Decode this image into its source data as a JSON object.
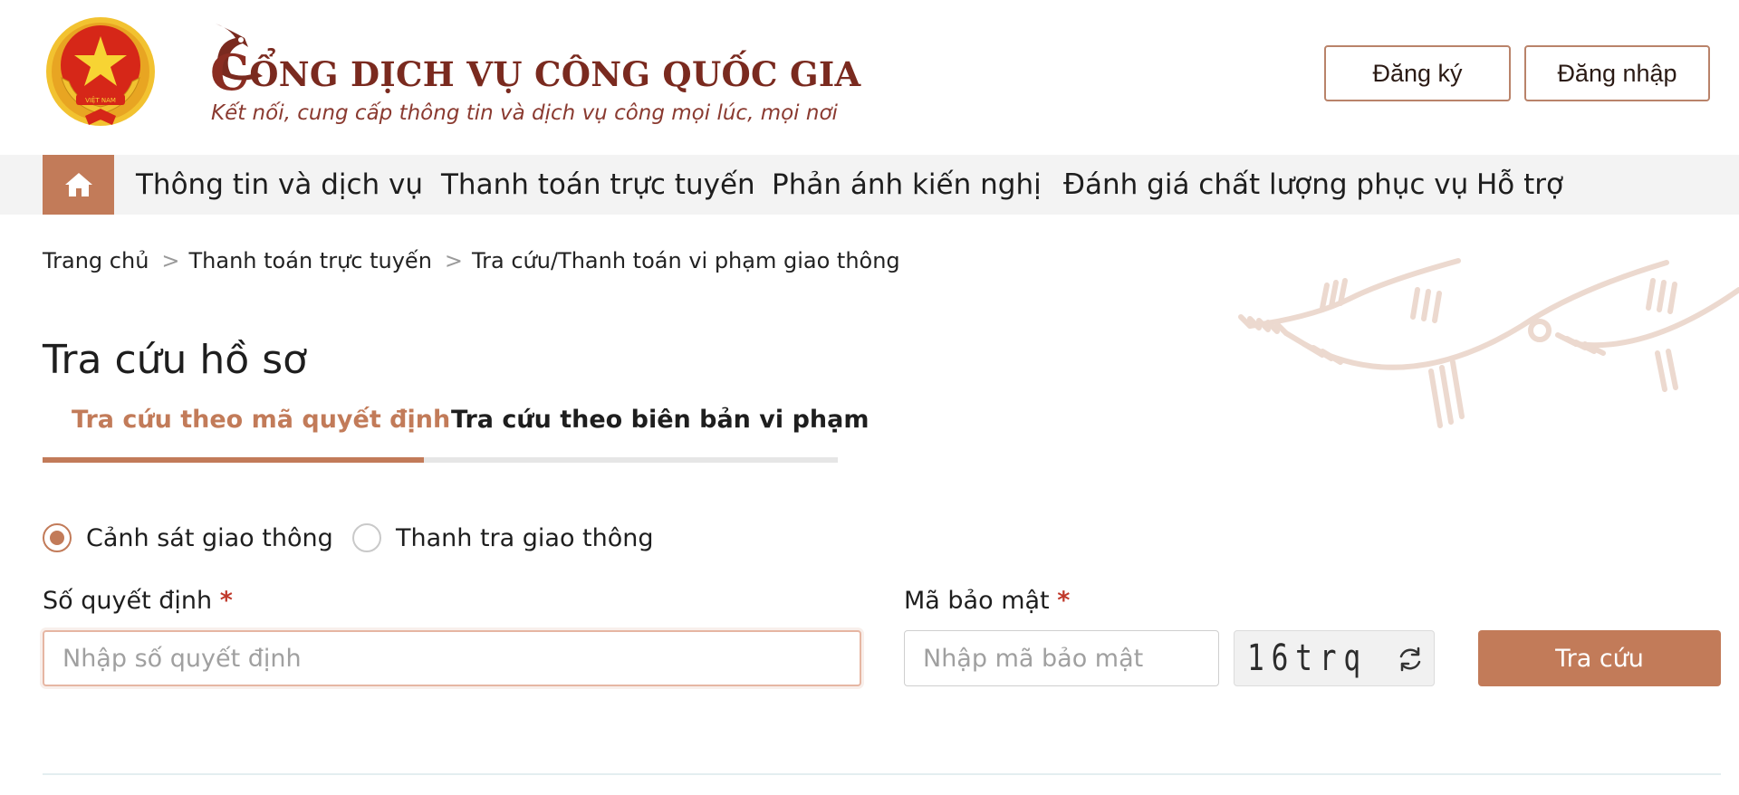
{
  "header": {
    "title_first_letter": "C",
    "title_rest": "ỔNG DỊCH VỤ CÔNG QUỐC GIA",
    "tagline": "Kết nối, cung cấp thông tin và dịch vụ công mọi lúc, mọi nơi",
    "emblem_text": "VIỆT NAM",
    "register_label": "Đăng ký",
    "login_label": "Đăng nhập"
  },
  "nav": {
    "home_icon": "home-icon",
    "items": [
      {
        "label": "Thông tin và dịch vụ"
      },
      {
        "label": "Thanh toán trực tuyến"
      },
      {
        "label": "Phản ánh kiến nghị"
      },
      {
        "label": "Đánh giá chất lượng phục vụ"
      },
      {
        "label": "Hỗ trợ"
      }
    ]
  },
  "breadcrumb": {
    "items": [
      "Trang chủ",
      "Thanh toán trực tuyến",
      "Tra cứu/Thanh toán vi phạm giao thông"
    ],
    "separator": ">"
  },
  "page": {
    "title": "Tra cứu hồ sơ"
  },
  "tabs": [
    {
      "label": "Tra cứu theo mã quyết định",
      "active": true
    },
    {
      "label": "Tra cứu theo biên bản vi phạm",
      "active": false
    }
  ],
  "radios": [
    {
      "label": "Cảnh sát giao thông",
      "checked": true
    },
    {
      "label": "Thanh tra giao thông",
      "checked": false
    }
  ],
  "form": {
    "decision_label": "Số quyết định",
    "decision_placeholder": "Nhập số quyết định",
    "decision_value": "",
    "security_label": "Mã bảo mật",
    "security_placeholder": "Nhập mã bảo mật",
    "required_mark": "*",
    "captcha_text": "16trq",
    "refresh_icon": "refresh-icon",
    "submit_label": "Tra cứu"
  },
  "colors": {
    "accent": "#c27b59",
    "title": "#7a2a1f",
    "nav_bg": "#f3f3f3",
    "required": "#c0392b",
    "emblem_red": "#d62718",
    "emblem_gold": "#f2c230"
  }
}
